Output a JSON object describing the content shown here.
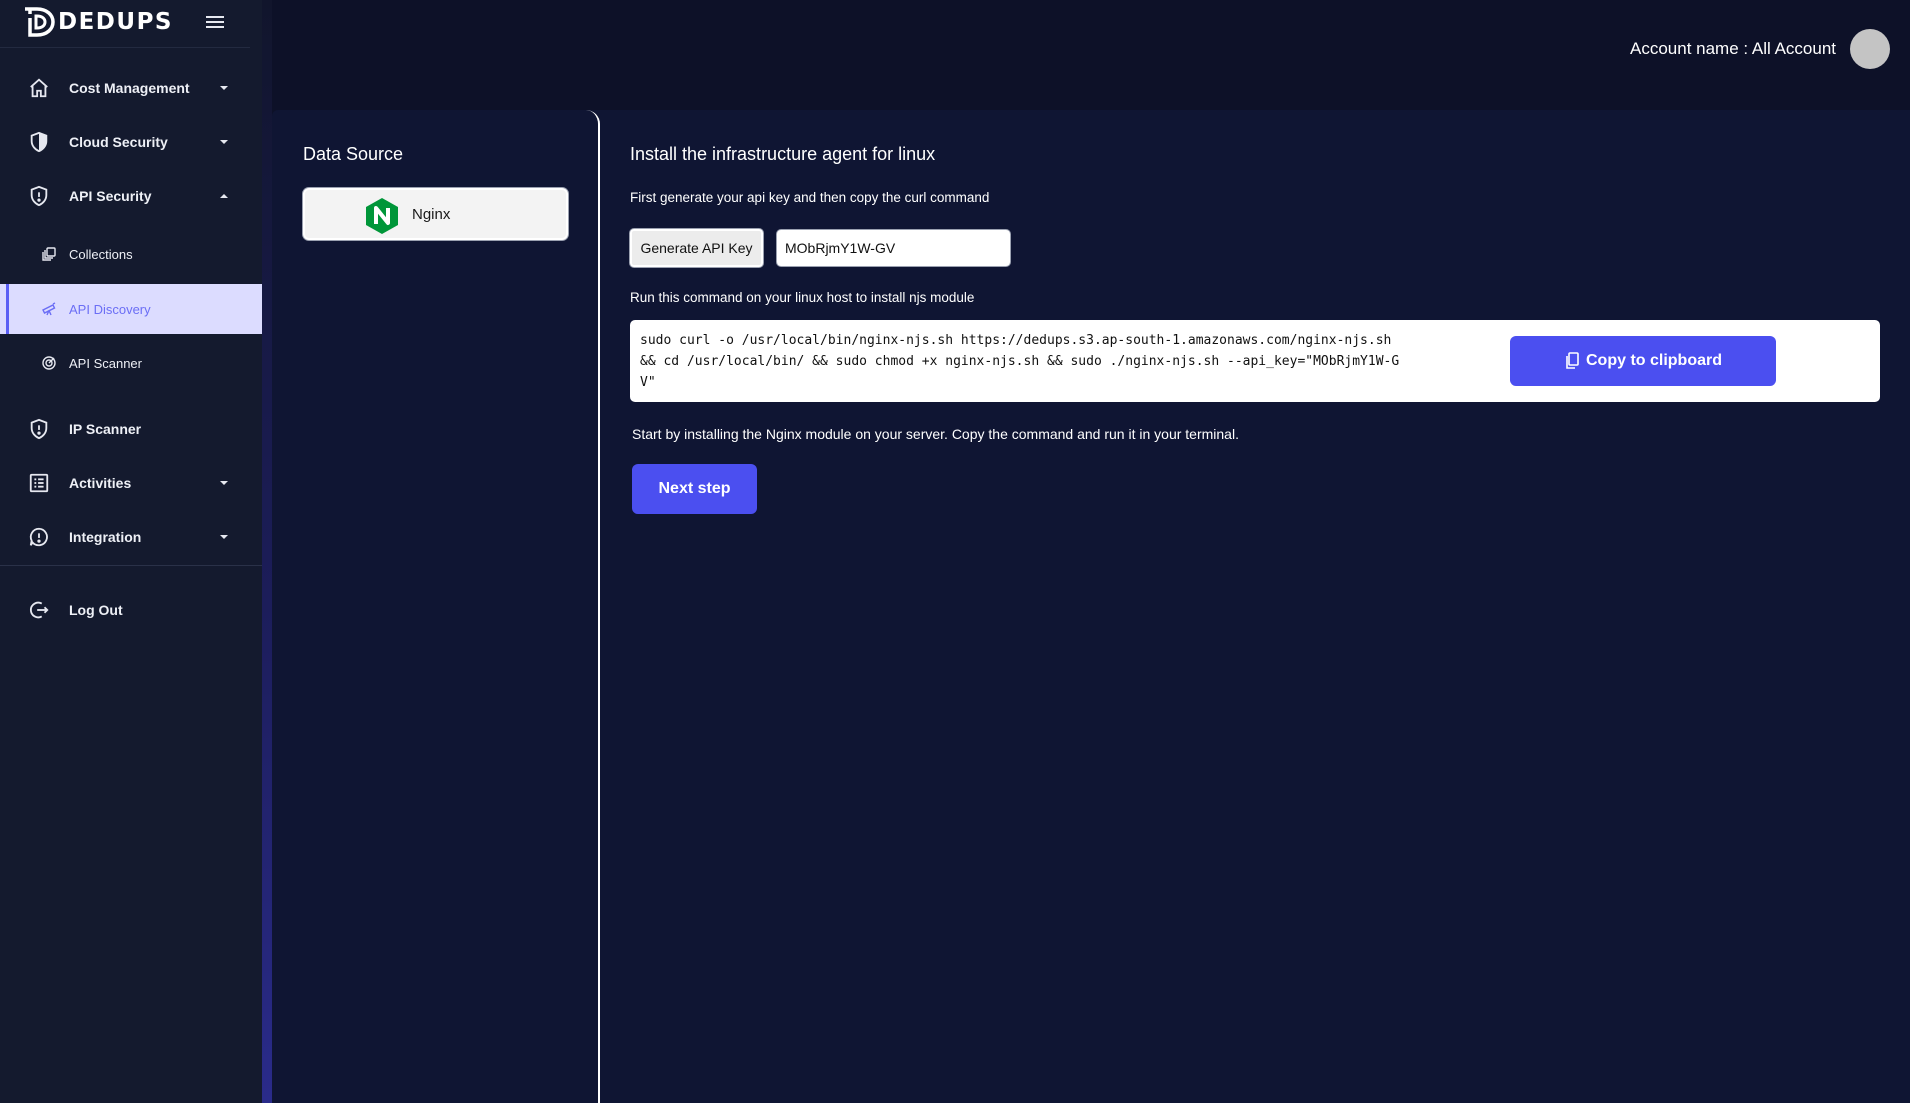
{
  "brand": {
    "name": "DEDUPS"
  },
  "sidebar": {
    "items": [
      {
        "label": "Cost Management",
        "icon": "home-icon",
        "has_dropdown": true
      },
      {
        "label": "Cloud Security",
        "icon": "shield-icon",
        "has_dropdown": true
      },
      {
        "label": "API Security",
        "icon": "shield-alert-icon",
        "has_dropdown": true,
        "expanded": true
      },
      {
        "label": "Collections",
        "icon": "collections-icon",
        "sub": true
      },
      {
        "label": "API Discovery",
        "icon": "telescope-icon",
        "sub": true,
        "active": true
      },
      {
        "label": "API Scanner",
        "icon": "radar-icon",
        "sub": true
      },
      {
        "label": "IP Scanner",
        "icon": "shield-alert-icon"
      },
      {
        "label": "Activities",
        "icon": "list-icon",
        "has_dropdown": true
      },
      {
        "label": "Integration",
        "icon": "alert-bubble-icon",
        "has_dropdown": true
      },
      {
        "label": "Log Out",
        "icon": "logout-icon"
      }
    ]
  },
  "header": {
    "account_text": "Account name : All Account"
  },
  "datasource": {
    "title": "Data Source",
    "selected": "Nginx"
  },
  "main": {
    "title": "Install the infrastructure agent for linux",
    "desc1": "First generate your api key and then copy the curl command",
    "generate_label": "Generate API Key",
    "api_key_value": "MObRjmY1W-GV",
    "desc2": "Run this command on your linux host to install njs module",
    "command": "sudo curl -o /usr/local/bin/nginx-njs.sh https://dedups.s3.ap-south-1.amazonaws.com/nginx-njs.sh && cd /usr/local/bin/ && sudo chmod +x nginx-njs.sh && sudo ./nginx-njs.sh --api_key=\"MObRjmY1W-GV\"",
    "copy_label": "Copy to clipboard",
    "desc3": "Start by installing the Nginx module on your server. Copy the command and run it in your terminal.",
    "next_label": "Next step"
  },
  "colors": {
    "accent": "#4b4ff0",
    "sidebar_bg": "#141a2e",
    "panel_bg": "#0f1533",
    "active_item_bg": "#dcdcff",
    "nginx_green": "#009639"
  }
}
